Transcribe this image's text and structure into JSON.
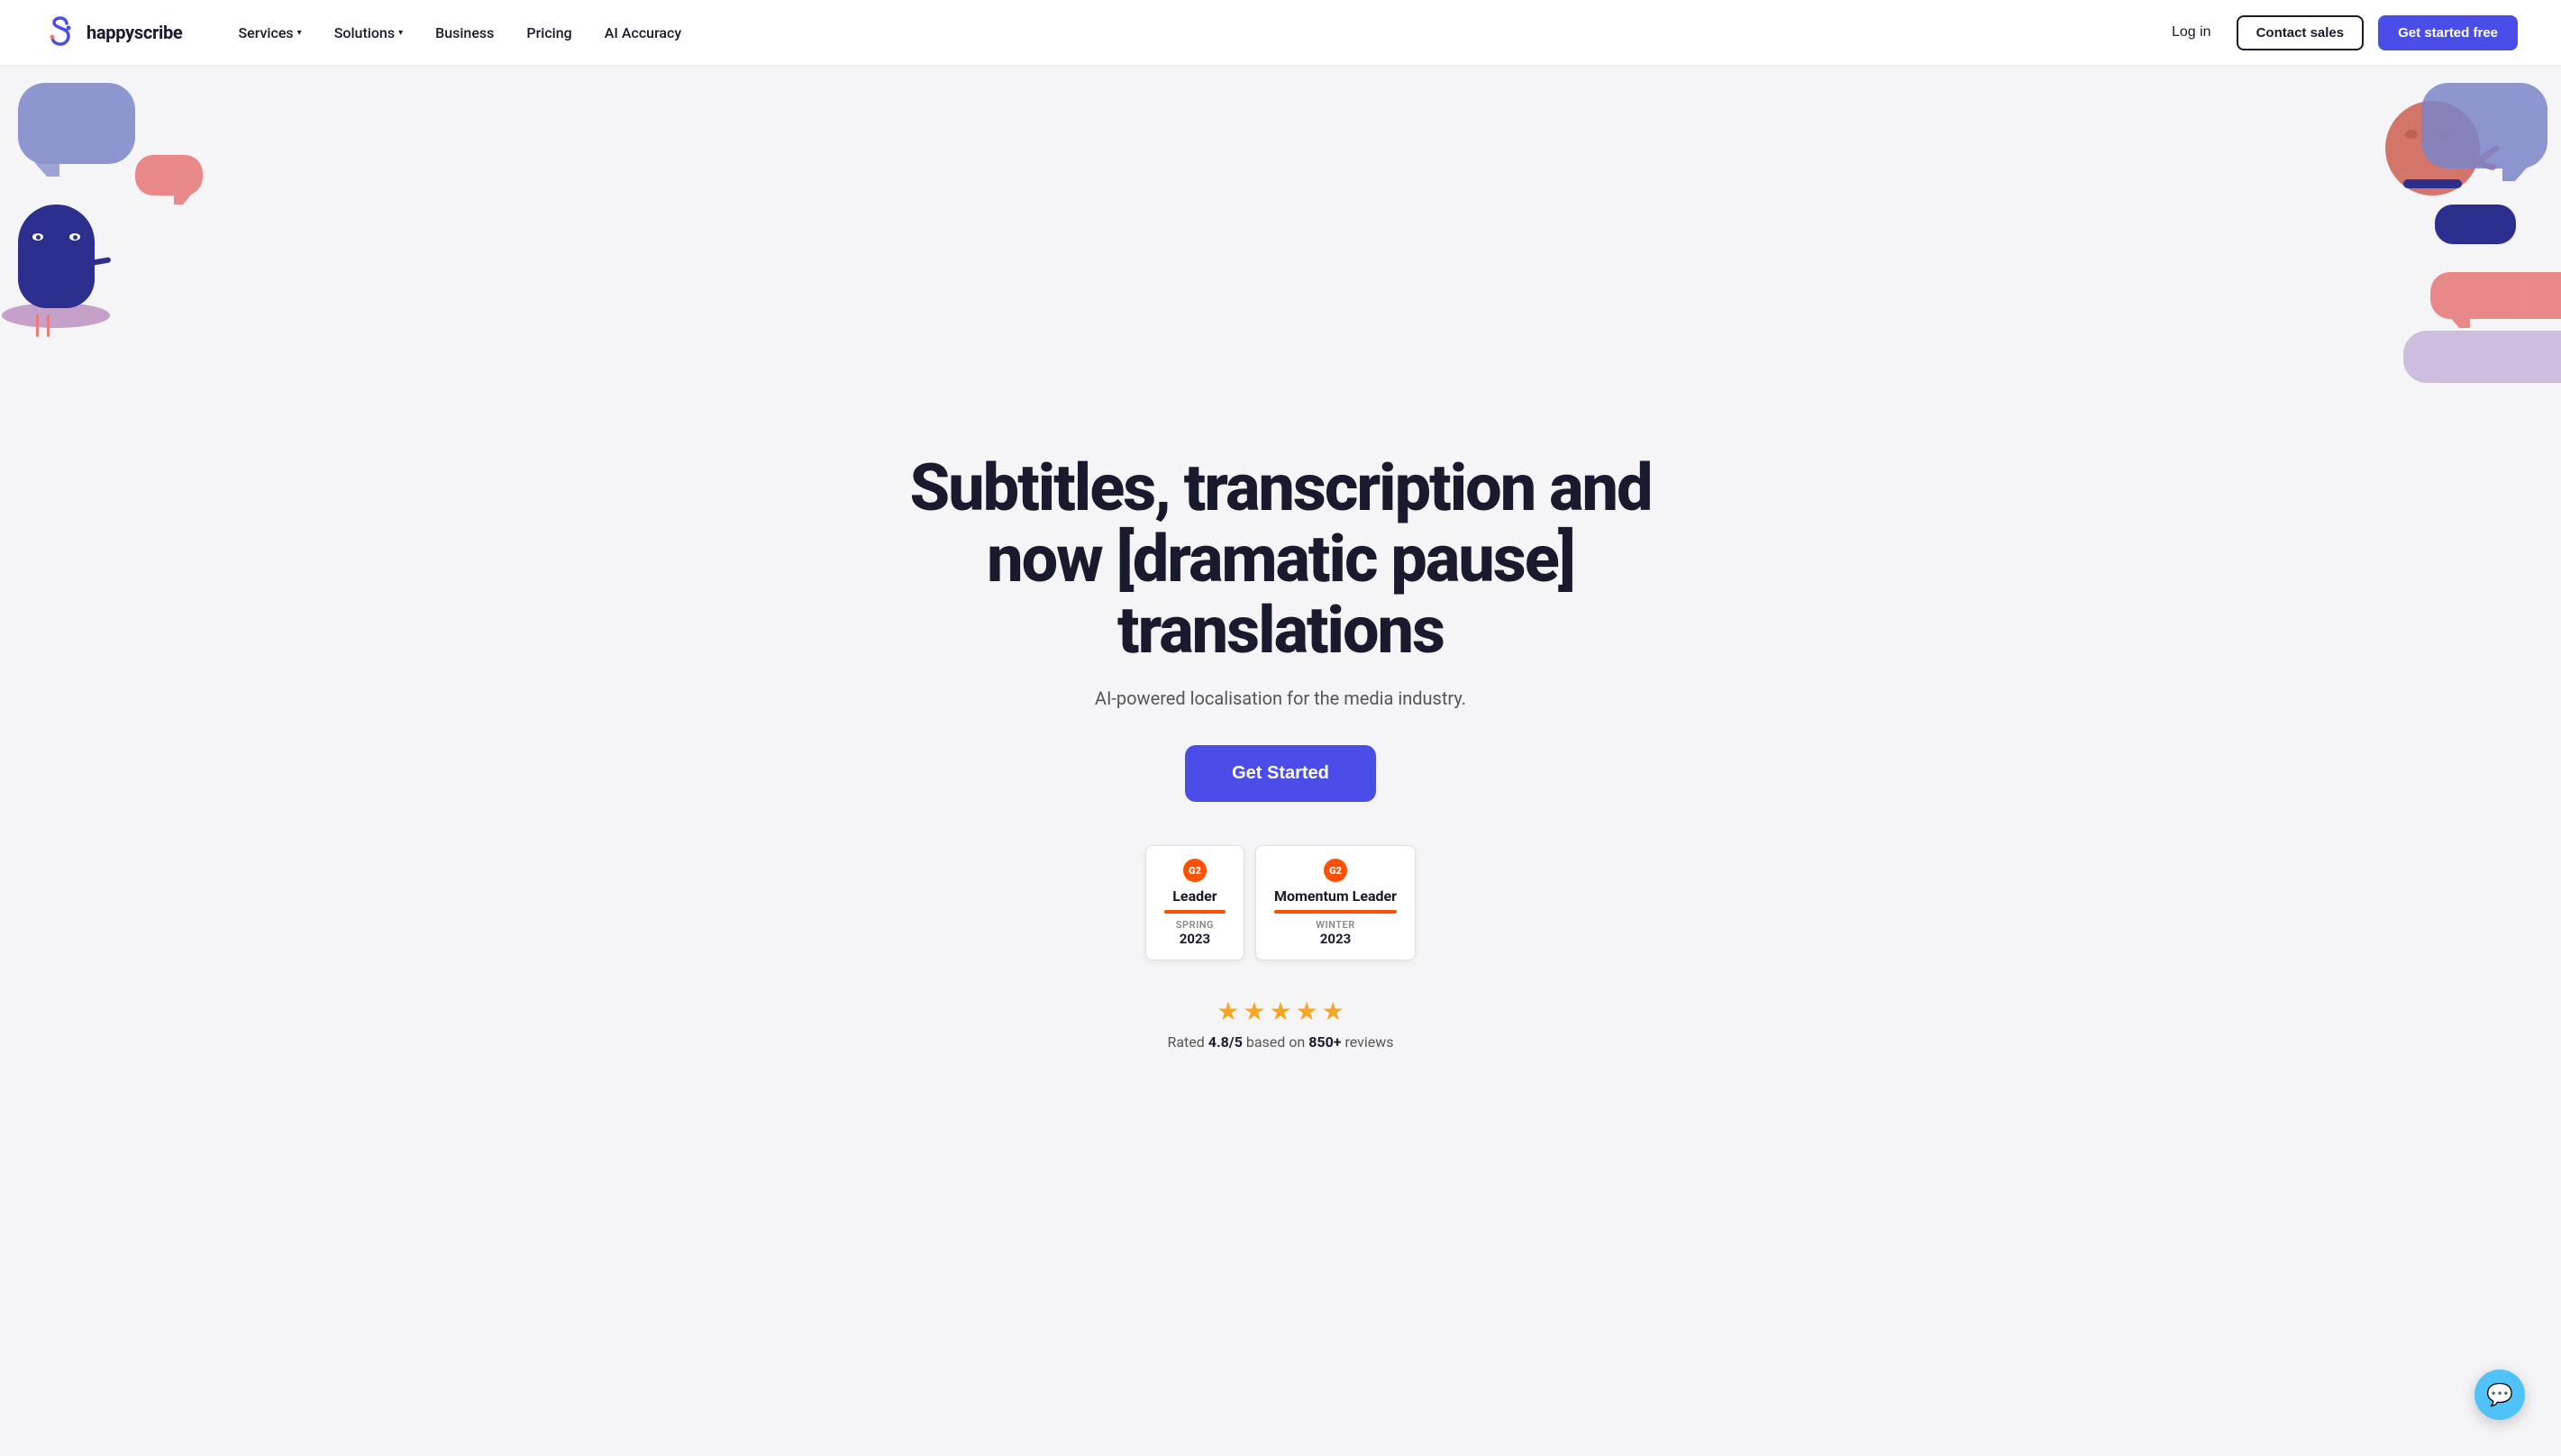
{
  "brand": {
    "name": "happyscribe",
    "logo_alt": "HappyScribe logo"
  },
  "nav": {
    "links": [
      {
        "label": "Services",
        "has_dropdown": true
      },
      {
        "label": "Solutions",
        "has_dropdown": true
      },
      {
        "label": "Business",
        "has_dropdown": false
      },
      {
        "label": "Pricing",
        "has_dropdown": false
      },
      {
        "label": "AI Accuracy",
        "has_dropdown": false
      }
    ],
    "login_label": "Log in",
    "contact_label": "Contact sales",
    "getstarted_label": "Get started free"
  },
  "hero": {
    "title": "Subtitles, transcription and now [dramatic pause] translations",
    "subtitle": "AI-powered localisation for the media industry.",
    "cta_label": "Get Started"
  },
  "badges": [
    {
      "g2_label": "G2",
      "title": "Leader",
      "season": "SPRING",
      "year": "2023"
    },
    {
      "g2_label": "G2",
      "title": "Momentum Leader",
      "season": "WINTER",
      "year": "2023"
    }
  ],
  "rating": {
    "score": "4.8/5",
    "review_count": "850+",
    "text_prefix": "Rated ",
    "text_suffix": " based on ",
    "text_end": " reviews"
  },
  "colors": {
    "accent": "#4a4de7",
    "brand_dark": "#1a1a2e",
    "star": "#f5a623",
    "badge_red": "#ff4f00",
    "chat_blue": "#4fc3f7"
  }
}
